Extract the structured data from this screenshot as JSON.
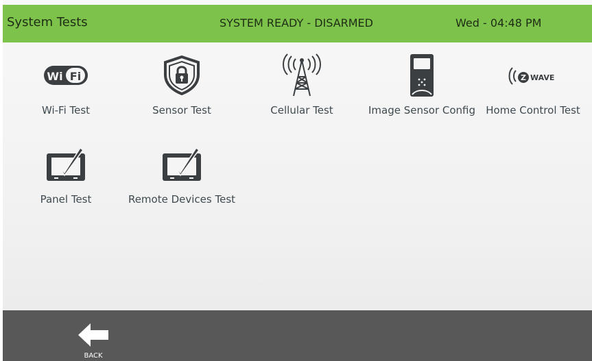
{
  "header": {
    "title": "System Tests",
    "status": "SYSTEM READY - DISARMED",
    "datetime": "Wed - 04:48 PM"
  },
  "tests": [
    {
      "label": "Wi-Fi Test",
      "icon": "wifi-icon",
      "icon_text": "Wi Fi"
    },
    {
      "label": "Sensor Test",
      "icon": "shield-lock-icon"
    },
    {
      "label": "Cellular Test",
      "icon": "cell-tower-icon"
    },
    {
      "label": "Image Sensor Config",
      "icon": "image-sensor-icon"
    },
    {
      "label": "Home Control Test",
      "icon": "zwave-icon",
      "icon_text": "WAVE"
    },
    {
      "label": "Panel Test",
      "icon": "panel-check-icon"
    },
    {
      "label": "Remote Devices Test",
      "icon": "panel-check-icon"
    }
  ],
  "footer": {
    "back_label": "BACK"
  },
  "colors": {
    "header": "#7cc24b",
    "footer": "#585858",
    "icon": "#3b3f42"
  }
}
